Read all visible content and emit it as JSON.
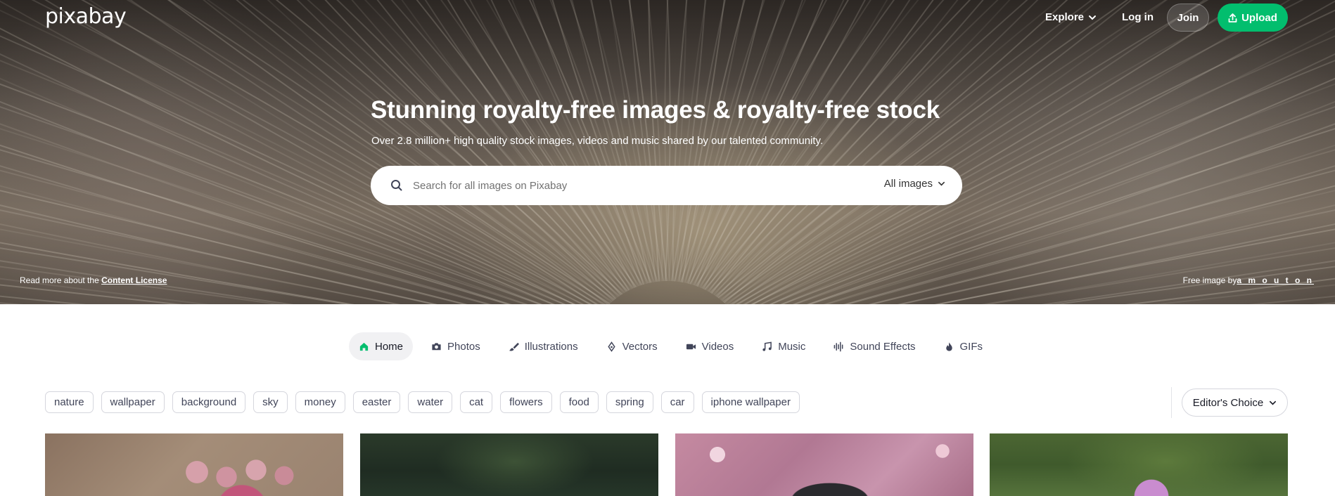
{
  "header": {
    "logo": "pixabay",
    "explore_label": "Explore",
    "login_label": "Log in",
    "join_label": "Join",
    "upload_label": "Upload",
    "accent_color": "#02be6e"
  },
  "hero": {
    "title": "Stunning royalty-free images & royalty-free stock",
    "subtitle": "Over 2.8 million+ high quality stock images, videos and music shared by our talented community.",
    "search": {
      "placeholder": "Search for all images on Pixabay",
      "filter_label": "All images",
      "icon": "search-icon"
    },
    "license_text": "Read more about the",
    "license_link": "Content License",
    "credit_text": "Free image by",
    "credit_author": "a m o u t o n"
  },
  "media_tabs": [
    {
      "label": "Home",
      "icon": "home-icon",
      "active": true
    },
    {
      "label": "Photos",
      "icon": "camera-icon"
    },
    {
      "label": "Illustrations",
      "icon": "brush-icon"
    },
    {
      "label": "Vectors",
      "icon": "pen-nib-icon"
    },
    {
      "label": "Videos",
      "icon": "video-camera-icon"
    },
    {
      "label": "Music",
      "icon": "music-note-icon"
    },
    {
      "label": "Sound Effects",
      "icon": "waveform-icon"
    },
    {
      "label": "GIFs",
      "icon": "flame-icon"
    }
  ],
  "tags": [
    "nature",
    "wallpaper",
    "background",
    "sky",
    "money",
    "easter",
    "water",
    "cat",
    "flowers",
    "food",
    "spring",
    "car",
    "iphone wallpaper"
  ],
  "sort": {
    "label": "Editor's Choice"
  }
}
